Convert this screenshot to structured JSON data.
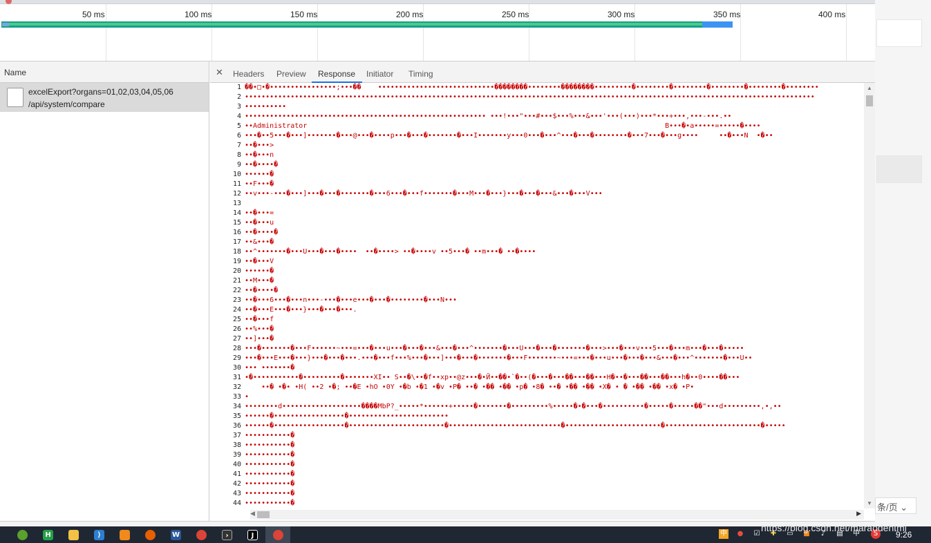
{
  "timeline": {
    "ticks": [
      "50 ms",
      "100 ms",
      "150 ms",
      "200 ms",
      "250 ms",
      "300 ms",
      "350 ms",
      "400 ms"
    ]
  },
  "name_pane": {
    "header": "Name",
    "request": {
      "name": "excelExport?organs=01,02,03,04,05,06",
      "path": "/api/system/compare"
    }
  },
  "detail_tabs": {
    "close_label": "✕",
    "tabs": [
      "Headers",
      "Preview",
      "Response",
      "Initiator",
      "Timing"
    ],
    "active": "Response"
  },
  "response_lines": [
    "��•□•�••••••••••••••••;•••��    ••••••••••••••••••••••••••••��������••••••••��������•••••••••�••••••••�••••••••�••••••••�••••••••�••••••••",
    "•••••••••••••••••••••••••••••••••••••••••••••••••••••••••••••••••••••••••••••••••••••••••••••••••••••••••••••••••••••••••••••••••••••••••",
    "••••••••••",
    "•••••••••••••••••••••••••••••••••••••••••••••••••••••••••• •••!•••\"•••#•••$•••%•••&•••'•••(•••)•••*•••+•••,•••-•••.••",
    "••Administrator                                                                                      B•••�•a•••••=•••••�••••",
    "•••�••5•••�•••]•••••••�•••@•••�••••p•••�•••�•••••••�•••I•••••••y•••0•••�•••^•••�•••�••••••••�•••7•••�•••g••••     ••�•••N  •�••",
    "••�•••>",
    "••�•••n",
    "••�••••�",
    "••••••�",
    "••F•••�",
    "••v•••-•••�•••]•••�•••�•••••••�•••6•••�•••f•••••••�•••M•••�•••}•••�•••�•••&•••�•••V•••",
    "",
    "••�•••=",
    "••�•••u",
    "••�••••�",
    "••&•••�",
    "••^•••••••�•••U•••�•••�••••  ••�••••> ••�••••v ••5•••� ••m•••� ••�••••",
    "••�•••V",
    "••••••�",
    "••M•••�",
    "••�••••�",
    "••�•••6•••�•••n•••-•••�•••e•••�•••�••••••••�•••N•••",
    "••�•••E•••�•••}•••�•••�•••.",
    "••�•••f",
    "••%•••�",
    "••]•••�",
    "•••�•••••••�•••F••••••~•••=•••�•••u•••�•••�•••&•••�•••^•••••••�•••U•••�•••�•••••••�•••>•••�•••v•••5•••�•••m•••�•••�•••••",
    "•••�•••E•••�•••}•••�•••�•••.•••�•••f•••%•••�•••]•••�•••�•••••••�•••F•••••••~•••=•••�•••u•••�•••�•••&•••�•••^•••••••�•••U••",
    "••• •••••••�",
    "•�•••••••••••�•••••••••�•••••••XI•• S••�\\••�f••xp••@z•••�•Й••��•`�••(�•••�•••��•••��•••H�••�•••��•••��•••h�••0••••��•••",
    "    ••� •�• •H( ••2 •�; ••�E •hO •0Y •�b •�1 •�v •P� ••� •�� •�� •p� •8� ••� •�� •�� •X� • � •�� •�� •x� •P•",
    "•",
    "••••••••d•••••••••••••••••••����MbP?_•••••*••••••+•••••�•••••••�•••••••••%•••••�•�•••�••••••••••�•••••�•••••��\"•••d•••••••••,•,••",
    "••••••�•••••••••••••••••�••••••••••••••••••••••••",
    "••••••�•••••••••••••••••�•••••••••••••••••••••••�•••••••••••••••••••••••••••�•••••••••••••••••••••••�•••••••••••••••••••••••�•••••",
    "•••••••••••�",
    "•••••••••••�",
    "•••••••••••�",
    "•••••••••••�",
    "•••••••••••�",
    "•••••••••••�",
    "•••••••••••�",
    "•••••••••••�",
    ""
  ],
  "behind_page": {
    "perpage_label": "条/页"
  },
  "taskbar": {
    "time": "9:26",
    "icons": [
      "hbuilder-icon",
      "h-icon",
      "folder-icon",
      "vscode-icon",
      "app-icon",
      "firefox-icon",
      "word-icon",
      "chrome-icon",
      "terminal-icon",
      "intellij-icon",
      "chrome-icon"
    ]
  },
  "watermark": "https://blog.csdn.net/maraodehtml"
}
